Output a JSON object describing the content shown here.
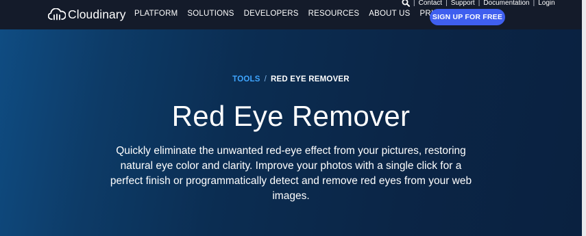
{
  "header": {
    "logo_text": "Cloudinary",
    "nav": [
      "PLATFORM",
      "SOLUTIONS",
      "DEVELOPERS",
      "RESOURCES",
      "ABOUT US",
      "PRICING"
    ],
    "utility_links": [
      "Contact",
      "Support",
      "Documentation",
      "Login"
    ],
    "signup_label": "SIGN UP FOR FREE"
  },
  "breadcrumb": {
    "parent": "TOOLS",
    "separator": "/",
    "current": "RED EYE REMOVER"
  },
  "hero": {
    "title": "Red Eye Remover",
    "description": "Quickly eliminate the unwanted red-eye effect from your pictures, restoring natural eye color and clarity. Improve your photos with a single click for a perfect finish or programmatically detect and remove red eyes from your web images."
  },
  "colors": {
    "topbar": "#141b2a",
    "accent_button": "#3f5fef",
    "breadcrumb_link": "#3ea5ff"
  },
  "icons": {
    "logo": "cloud-logo-icon",
    "search": "search-icon"
  }
}
